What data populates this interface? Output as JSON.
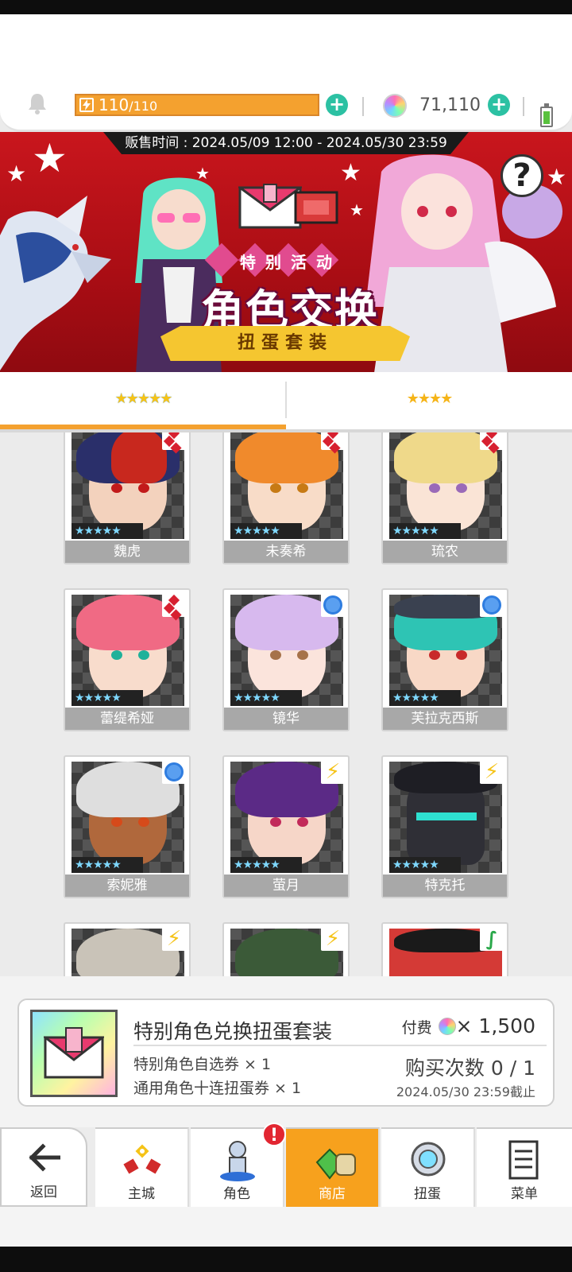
{
  "topbar": {
    "energy_current": "110",
    "energy_max": "/110",
    "gems": "71,110"
  },
  "banner": {
    "sale_time": "贩售时间 : 2024.05/09 12:00 - 2024.05/30 23:59",
    "tag": "特别活动",
    "title": "角色交换",
    "ribbon": "扭蛋套装",
    "help_label": "?"
  },
  "tabs": [
    {
      "stars": "★★★★★",
      "active": true
    },
    {
      "stars": "★★★★",
      "active": false
    }
  ],
  "characters": [
    {
      "name": "魏虎",
      "rarity": "★★★★★",
      "badge": "diamond"
    },
    {
      "name": "未奏希",
      "rarity": "★★★★★",
      "badge": "diamond"
    },
    {
      "name": "琉农",
      "rarity": "★★★★★",
      "badge": "diamond"
    },
    {
      "name": "蕾缇希娅",
      "rarity": "★★★★★",
      "badge": "diamond"
    },
    {
      "name": "镜华",
      "rarity": "★★★★★",
      "badge": "circle"
    },
    {
      "name": "芙拉克西斯",
      "rarity": "★★★★★",
      "badge": "circle"
    },
    {
      "name": "索妮雅",
      "rarity": "★★★★★",
      "badge": "circle"
    },
    {
      "name": "萤月",
      "rarity": "★★★★★",
      "badge": "bolt"
    },
    {
      "name": "特克托",
      "rarity": "★★★★★",
      "badge": "bolt"
    }
  ],
  "purchase": {
    "title": "特别角色兑换扭蛋套装",
    "price_label": "付费",
    "price_value": "× 1,500",
    "items": [
      "特别角色自选券 × 1",
      "通用角色十连扭蛋券 × 1"
    ],
    "count": "购买次数 0 / 1",
    "deadline": "2024.05/30 23:59截止"
  },
  "nav": {
    "back": "返回",
    "items": [
      "主城",
      "角色",
      "商店",
      "扭蛋",
      "菜单"
    ],
    "alert": "!"
  },
  "colors": {
    "accent": "#f4a12f",
    "banner_red": "#c9161d",
    "teal_plus": "#2cc1a3"
  }
}
